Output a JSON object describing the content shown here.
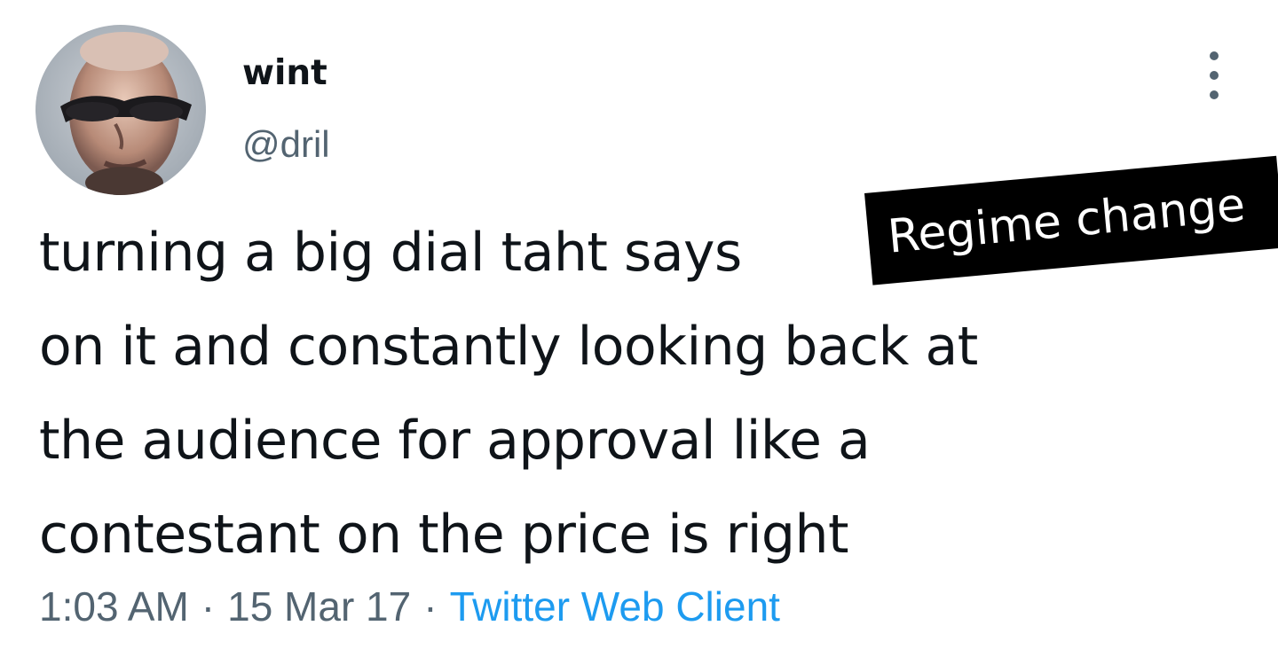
{
  "tweet": {
    "author": {
      "display_name": "wint",
      "handle": "@dril",
      "avatar_icon": "avatar-photo"
    },
    "more_icon": "more-options-icon",
    "text_lines": [
      "turning a big dial taht says",
      "on it and constantly looking back at",
      "the audience for approval like a",
      "contestant on the price is right"
    ],
    "sticker_text": "Regime change",
    "meta": {
      "time": "1:03 AM",
      "separator": "·",
      "date": "15 Mar 17",
      "source": "Twitter Web Client"
    }
  },
  "colors": {
    "text": "#0f1419",
    "secondary": "#536471",
    "link": "#1d9bf0",
    "sticker_bg": "#000000",
    "sticker_text": "#ffffff"
  }
}
